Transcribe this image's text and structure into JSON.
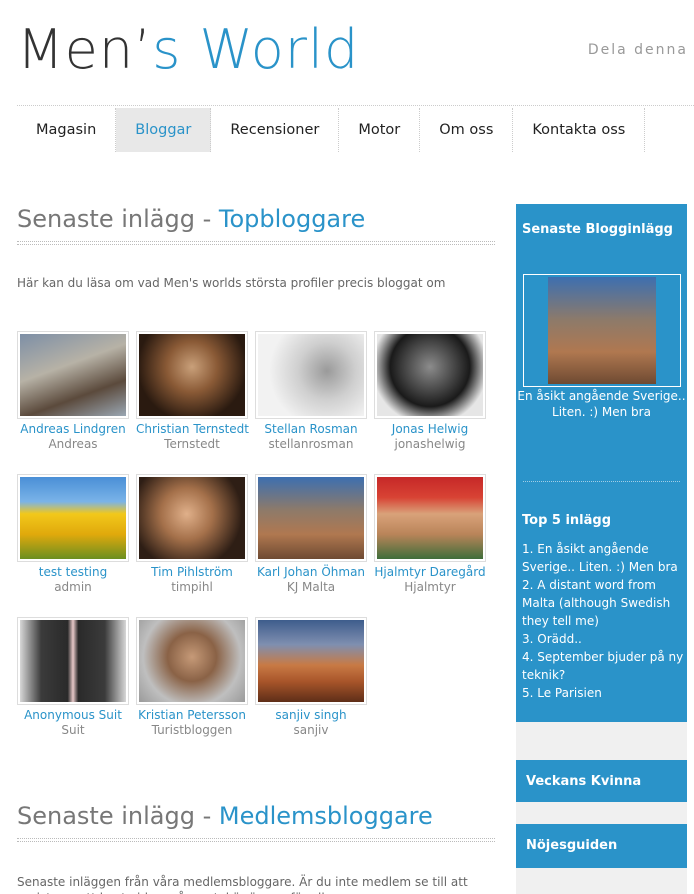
{
  "header": {
    "logo_part1": "Men",
    "logo_apostrophe": "’",
    "logo_part2": "s World",
    "share_label": "Dela denna"
  },
  "nav": {
    "items": [
      {
        "label": "Magasin"
      },
      {
        "label": "Bloggar"
      },
      {
        "label": "Recensioner"
      },
      {
        "label": "Motor"
      },
      {
        "label": "Om oss"
      },
      {
        "label": "Kontakta oss"
      }
    ],
    "active": "Bloggar"
  },
  "top_bloggers": {
    "title_prefix": "Senaste inlägg - ",
    "title_accent": "Topbloggare",
    "intro": "Här kan du läsa om vad Men's worlds största profiler precis bloggat om",
    "bloggers": [
      {
        "name": "Andreas Lindgren",
        "user": "Andreas"
      },
      {
        "name": "Christian Ternstedt",
        "user": "Ternstedt"
      },
      {
        "name": "Stellan Rosman",
        "user": "stellanrosman"
      },
      {
        "name": "Jonas Helwig",
        "user": "jonashelwig"
      },
      {
        "name": "test testing",
        "user": "admin"
      },
      {
        "name": "Tim Pihlström",
        "user": "timpihl"
      },
      {
        "name": "Karl Johan Öhman",
        "user": "KJ Malta"
      },
      {
        "name": "Hjalmtyr Daregård",
        "user": "Hjalmtyr"
      },
      {
        "name": "Anonymous Suit",
        "user": "Suit"
      },
      {
        "name": "Kristian Petersson",
        "user": "Turistbloggen"
      },
      {
        "name": "sanjiv singh",
        "user": "sanjiv"
      }
    ]
  },
  "member_bloggers": {
    "title_prefix": "Senaste inlägg - ",
    "title_accent": "Medlemsbloggare",
    "intro": "Senaste inläggen från våra medlemsbloggare. Är du inte medlem se till att registrera ett konto idag, vår portal är öppen för alla."
  },
  "sidebar": {
    "latest_heading": "Senaste Blogginlägg",
    "latest_caption": "En åsikt angående Sverige.. Liten. :) Men bra",
    "top5_heading": "Top 5 inlägg",
    "top5": [
      "1. En åsikt angående Sverige.. Liten. :) Men bra",
      "2. A distant word from Malta (although Swedish they tell me)",
      "3. Orädd..",
      "4. September bjuder på ny teknik?",
      "5. Le Parisien"
    ],
    "woman_heading": "Veckans Kvinna",
    "guide_heading": "Nöjesguiden"
  },
  "colors": {
    "accent": "#2a93c9",
    "nav_active_bg": "#e8e8e8"
  }
}
